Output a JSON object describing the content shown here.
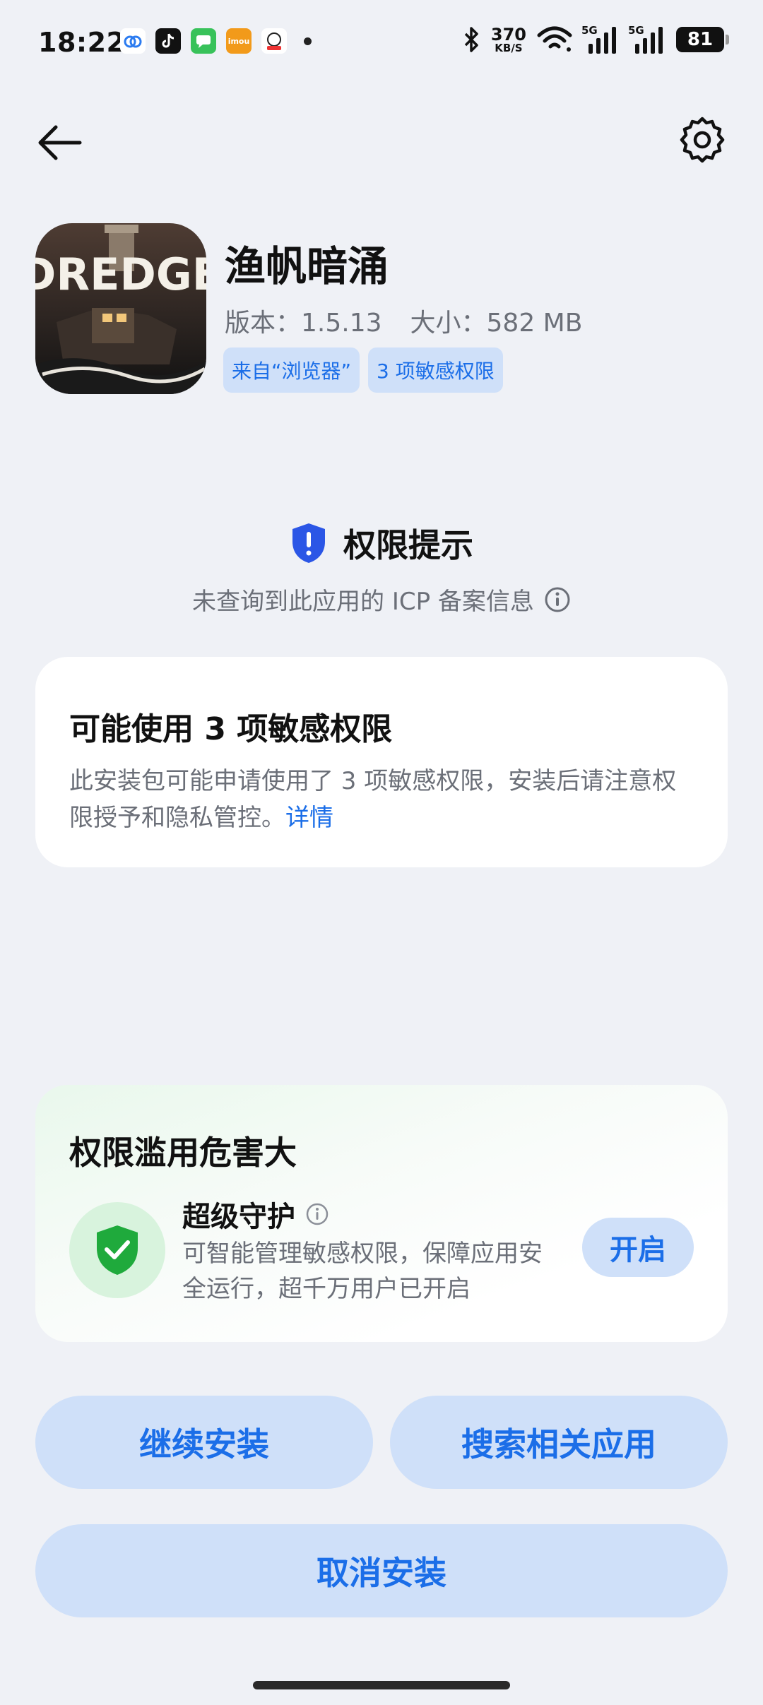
{
  "status_bar": {
    "time": "18:22",
    "net_speed_value": "370",
    "net_speed_unit": "KB/S",
    "signal1_label": "5G",
    "signal2_label": "5G",
    "battery": "81"
  },
  "notif_icons": [
    "cloud-app-icon",
    "tiktok-icon",
    "messages-icon",
    "imou-icon",
    "sf-express-icon"
  ],
  "app": {
    "icon_text": "DREDGE",
    "name": "渔帆暗涌",
    "version": "版本：1.5.13",
    "size": "大小：582 MB",
    "chip_source": "来自“浏览器”",
    "chip_perms": "3 项敏感权限"
  },
  "permission": {
    "title": "权限提示",
    "icp_note": "未查询到此应用的 ICP 备案信息"
  },
  "sensitive_card": {
    "title": "可能使用 3 项敏感权限",
    "desc": "此安装包可能申请使用了 3 项敏感权限，安装后请注意权限授予和隐私管控。",
    "link": "详情"
  },
  "protect_card": {
    "title": "权限滥用危害大",
    "feature": "超级守护",
    "desc": "可智能管理敏感权限，保障应用安全运行，超千万用户已开启",
    "button": "开启"
  },
  "buttons": {
    "continue": "继续安装",
    "search": "搜索相关应用",
    "cancel": "取消安装"
  },
  "colors": {
    "accent": "#1b6ee8",
    "chip_bg": "#cfe0f9",
    "background": "#eff1f6",
    "shield_green": "#1faa3c"
  }
}
